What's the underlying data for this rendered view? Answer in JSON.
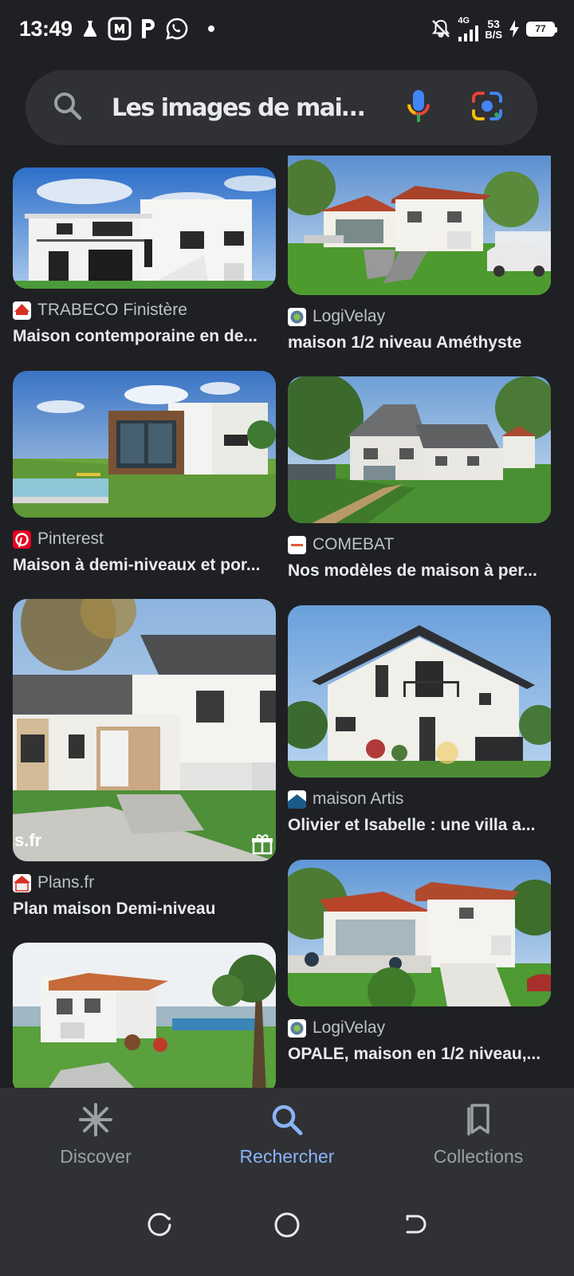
{
  "status_bar": {
    "time": "13:49",
    "network_type": "4G",
    "net_speed_value": "53",
    "net_speed_unit": "B/S",
    "battery_level": "77",
    "icons": [
      "lab-flask-icon",
      "app-badge-icon",
      "parking-p-icon",
      "whatsapp-icon",
      "notification-dot",
      "mute-bell-icon",
      "signal-icon",
      "charging-bolt-icon",
      "battery-icon"
    ]
  },
  "search": {
    "query": "Les images de maison a...",
    "icons": [
      "search-icon",
      "mic-icon",
      "google-lens-icon"
    ]
  },
  "results": {
    "left": [
      {
        "source": "TRABECO Finistère",
        "title": "Maison contemporaine en de...",
        "favicon_color": "#d93025"
      },
      {
        "source": "Pinterest",
        "title": "Maison à demi-niveaux et por...",
        "favicon_color": "#e60023"
      },
      {
        "source": "Plans.fr",
        "title": "Plan maison Demi-niveau",
        "favicon_color": "#d93025"
      },
      {
        "source": "",
        "title": ""
      }
    ],
    "right": [
      {
        "source": "LogiVelay",
        "title": "maison 1/2 niveau Améthyste",
        "favicon_color": "#4a7cae"
      },
      {
        "source": "COMEBAT",
        "title": "Nos modèles de maison à per...",
        "favicon_color": "#ffffff"
      },
      {
        "source": "maison Artis",
        "title": "Olivier et Isabelle : une villa a...",
        "favicon_color": "#1a5a8a"
      },
      {
        "source": "LogiVelay",
        "title": "OPALE, maison en 1/2 niveau,...",
        "favicon_color": "#4a7cae"
      }
    ],
    "watermark": "s.fr"
  },
  "bottom_nav": {
    "items": [
      {
        "label": "Discover",
        "icon": "asterisk-icon"
      },
      {
        "label": "Rechercher",
        "icon": "search-icon"
      },
      {
        "label": "Collections",
        "icon": "collections-icon"
      }
    ],
    "active": "Rechercher"
  },
  "colors": {
    "background": "#1f2023",
    "surface": "#303134",
    "accent": "#8ab4f8",
    "text": "#e8eaed",
    "muted": "#9aa0a6"
  }
}
